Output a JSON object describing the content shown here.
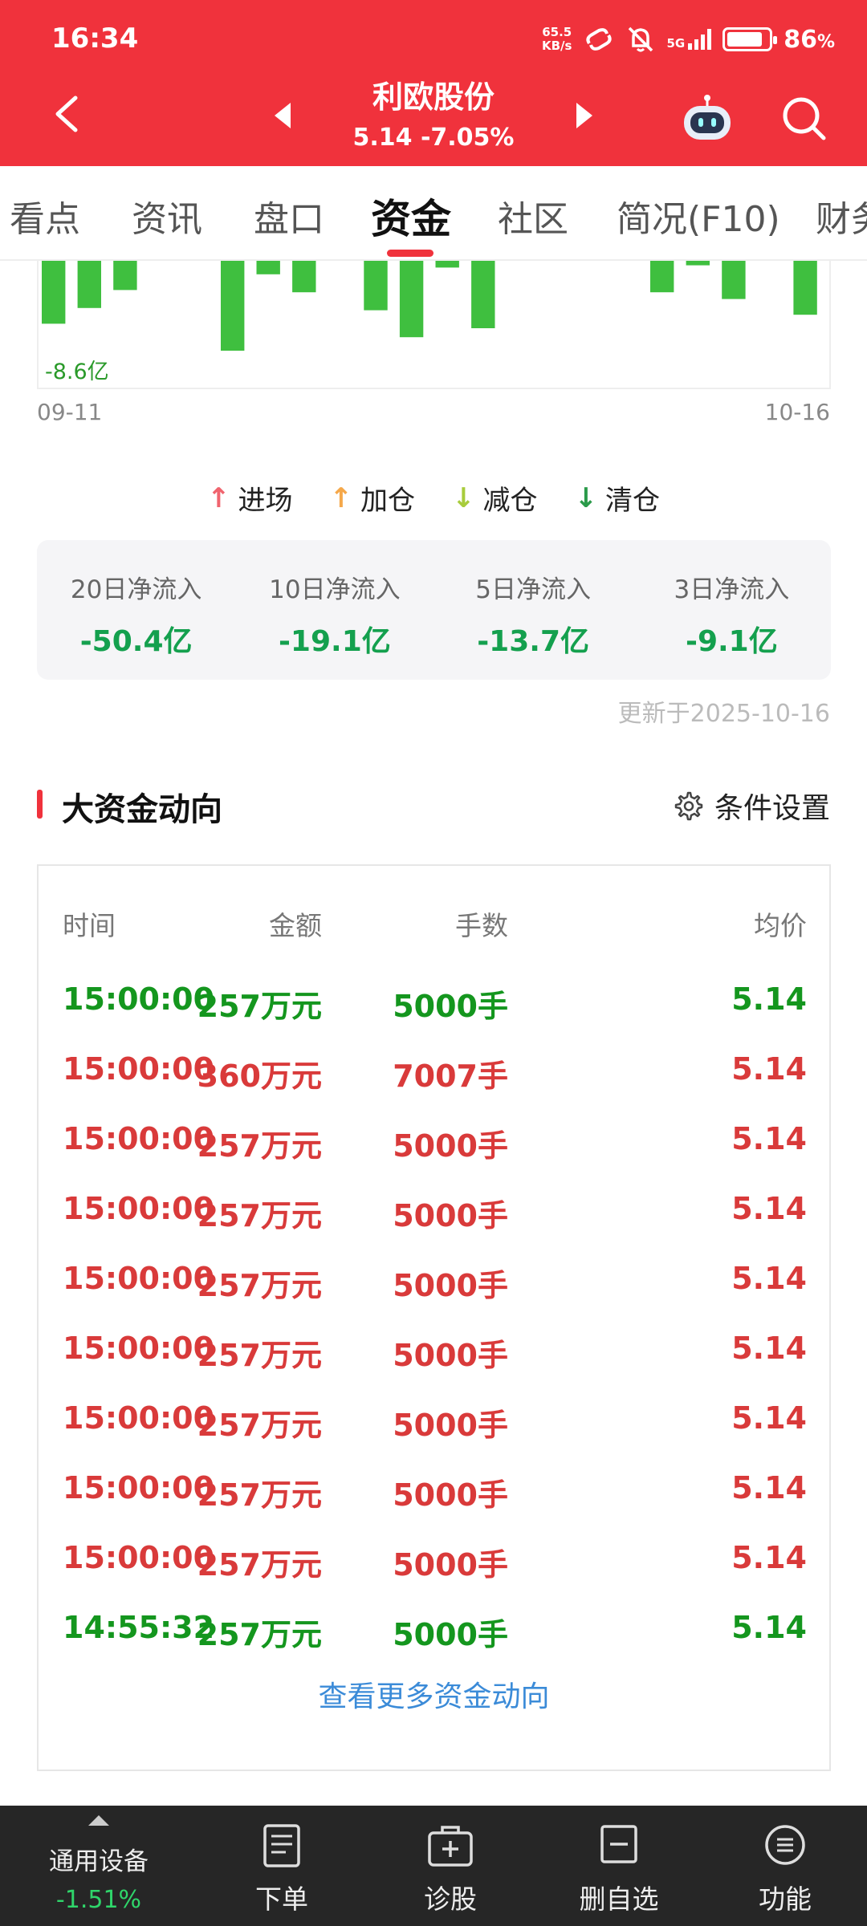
{
  "status_bar": {
    "time": "16:34",
    "net_speed_value": "65.5",
    "net_speed_unit": "KB/s",
    "network": "5G",
    "battery": "86",
    "battery_unit": "%",
    "battery_level": 0.86
  },
  "stock": {
    "name": "利欧股份",
    "price_change": "5.14 -7.05%"
  },
  "tabs": [
    {
      "label": "看点"
    },
    {
      "label": "资讯"
    },
    {
      "label": "盘口"
    },
    {
      "label": "资金"
    },
    {
      "label": "社区"
    },
    {
      "label": "简况(F10)"
    },
    {
      "label": "财务"
    }
  ],
  "chart": {
    "min_label": "-8.6亿",
    "x_start": "09-11",
    "x_end": "10-16"
  },
  "chart_data": {
    "type": "bar",
    "x_range": [
      "09-11",
      "10-16"
    ],
    "values": [
      -2.8,
      -2.1,
      -1.3,
      0,
      0,
      -4.0,
      -0.6,
      -1.4,
      0,
      -2.2,
      -3.4,
      -0.3,
      -3.0,
      0,
      0,
      0,
      0,
      -1.4,
      -0.2,
      -1.7,
      0,
      -2.4
    ],
    "annotation": "-8.6亿"
  },
  "legend": [
    {
      "label": "进场",
      "arrow": "↑",
      "color": "#f0646e"
    },
    {
      "label": "加仓",
      "arrow": "↑",
      "color": "#f5a84a"
    },
    {
      "label": "减仓",
      "arrow": "↓",
      "color": "#a8cc3c"
    },
    {
      "label": "清仓",
      "arrow": "↓",
      "color": "#2a9a4a"
    }
  ],
  "net_flows": [
    {
      "label": "20日净流入",
      "value": "-50.4亿"
    },
    {
      "label": "10日净流入",
      "value": "-19.1亿"
    },
    {
      "label": "5日净流入",
      "value": "-13.7亿"
    },
    {
      "label": "3日净流入",
      "value": "-9.1亿"
    }
  ],
  "updated": "更新于2025-10-16",
  "section": {
    "title": "大资金动向",
    "settings_label": "条件设置"
  },
  "table": {
    "headers": [
      "时间",
      "金额",
      "手数",
      "均价"
    ],
    "rows": [
      {
        "time": "15:00:00",
        "amount": "257万元",
        "lots": "5000手",
        "price": "5.14",
        "color": "#14961e"
      },
      {
        "time": "15:00:00",
        "amount": "360万元",
        "lots": "7007手",
        "price": "5.14",
        "color": "#d93a3a"
      },
      {
        "time": "15:00:00",
        "amount": "257万元",
        "lots": "5000手",
        "price": "5.14",
        "color": "#d93a3a"
      },
      {
        "time": "15:00:00",
        "amount": "257万元",
        "lots": "5000手",
        "price": "5.14",
        "color": "#d93a3a"
      },
      {
        "time": "15:00:00",
        "amount": "257万元",
        "lots": "5000手",
        "price": "5.14",
        "color": "#d93a3a"
      },
      {
        "time": "15:00:00",
        "amount": "257万元",
        "lots": "5000手",
        "price": "5.14",
        "color": "#d93a3a"
      },
      {
        "time": "15:00:00",
        "amount": "257万元",
        "lots": "5000手",
        "price": "5.14",
        "color": "#d93a3a"
      },
      {
        "time": "15:00:00",
        "amount": "257万元",
        "lots": "5000手",
        "price": "5.14",
        "color": "#d93a3a"
      },
      {
        "time": "15:00:00",
        "amount": "257万元",
        "lots": "5000手",
        "price": "5.14",
        "color": "#d93a3a"
      },
      {
        "time": "14:55:32",
        "amount": "257万元",
        "lots": "5000手",
        "price": "5.14",
        "color": "#14961e"
      }
    ],
    "more_label": "查看更多资金动向"
  },
  "bottom_bar": {
    "index_name": "通用设备",
    "index_change": "-1.51%",
    "items": [
      {
        "label": "下单",
        "icon": "order-icon"
      },
      {
        "label": "诊股",
        "icon": "diagnose-icon"
      },
      {
        "label": "删自选",
        "icon": "remove-watchlist-icon"
      },
      {
        "label": "功能",
        "icon": "menu-icon"
      }
    ]
  },
  "colors": {
    "brand_red": "#f0323c",
    "up_red": "#d93a3a",
    "down_green": "#14961e",
    "link_blue": "#3b8bd8"
  }
}
